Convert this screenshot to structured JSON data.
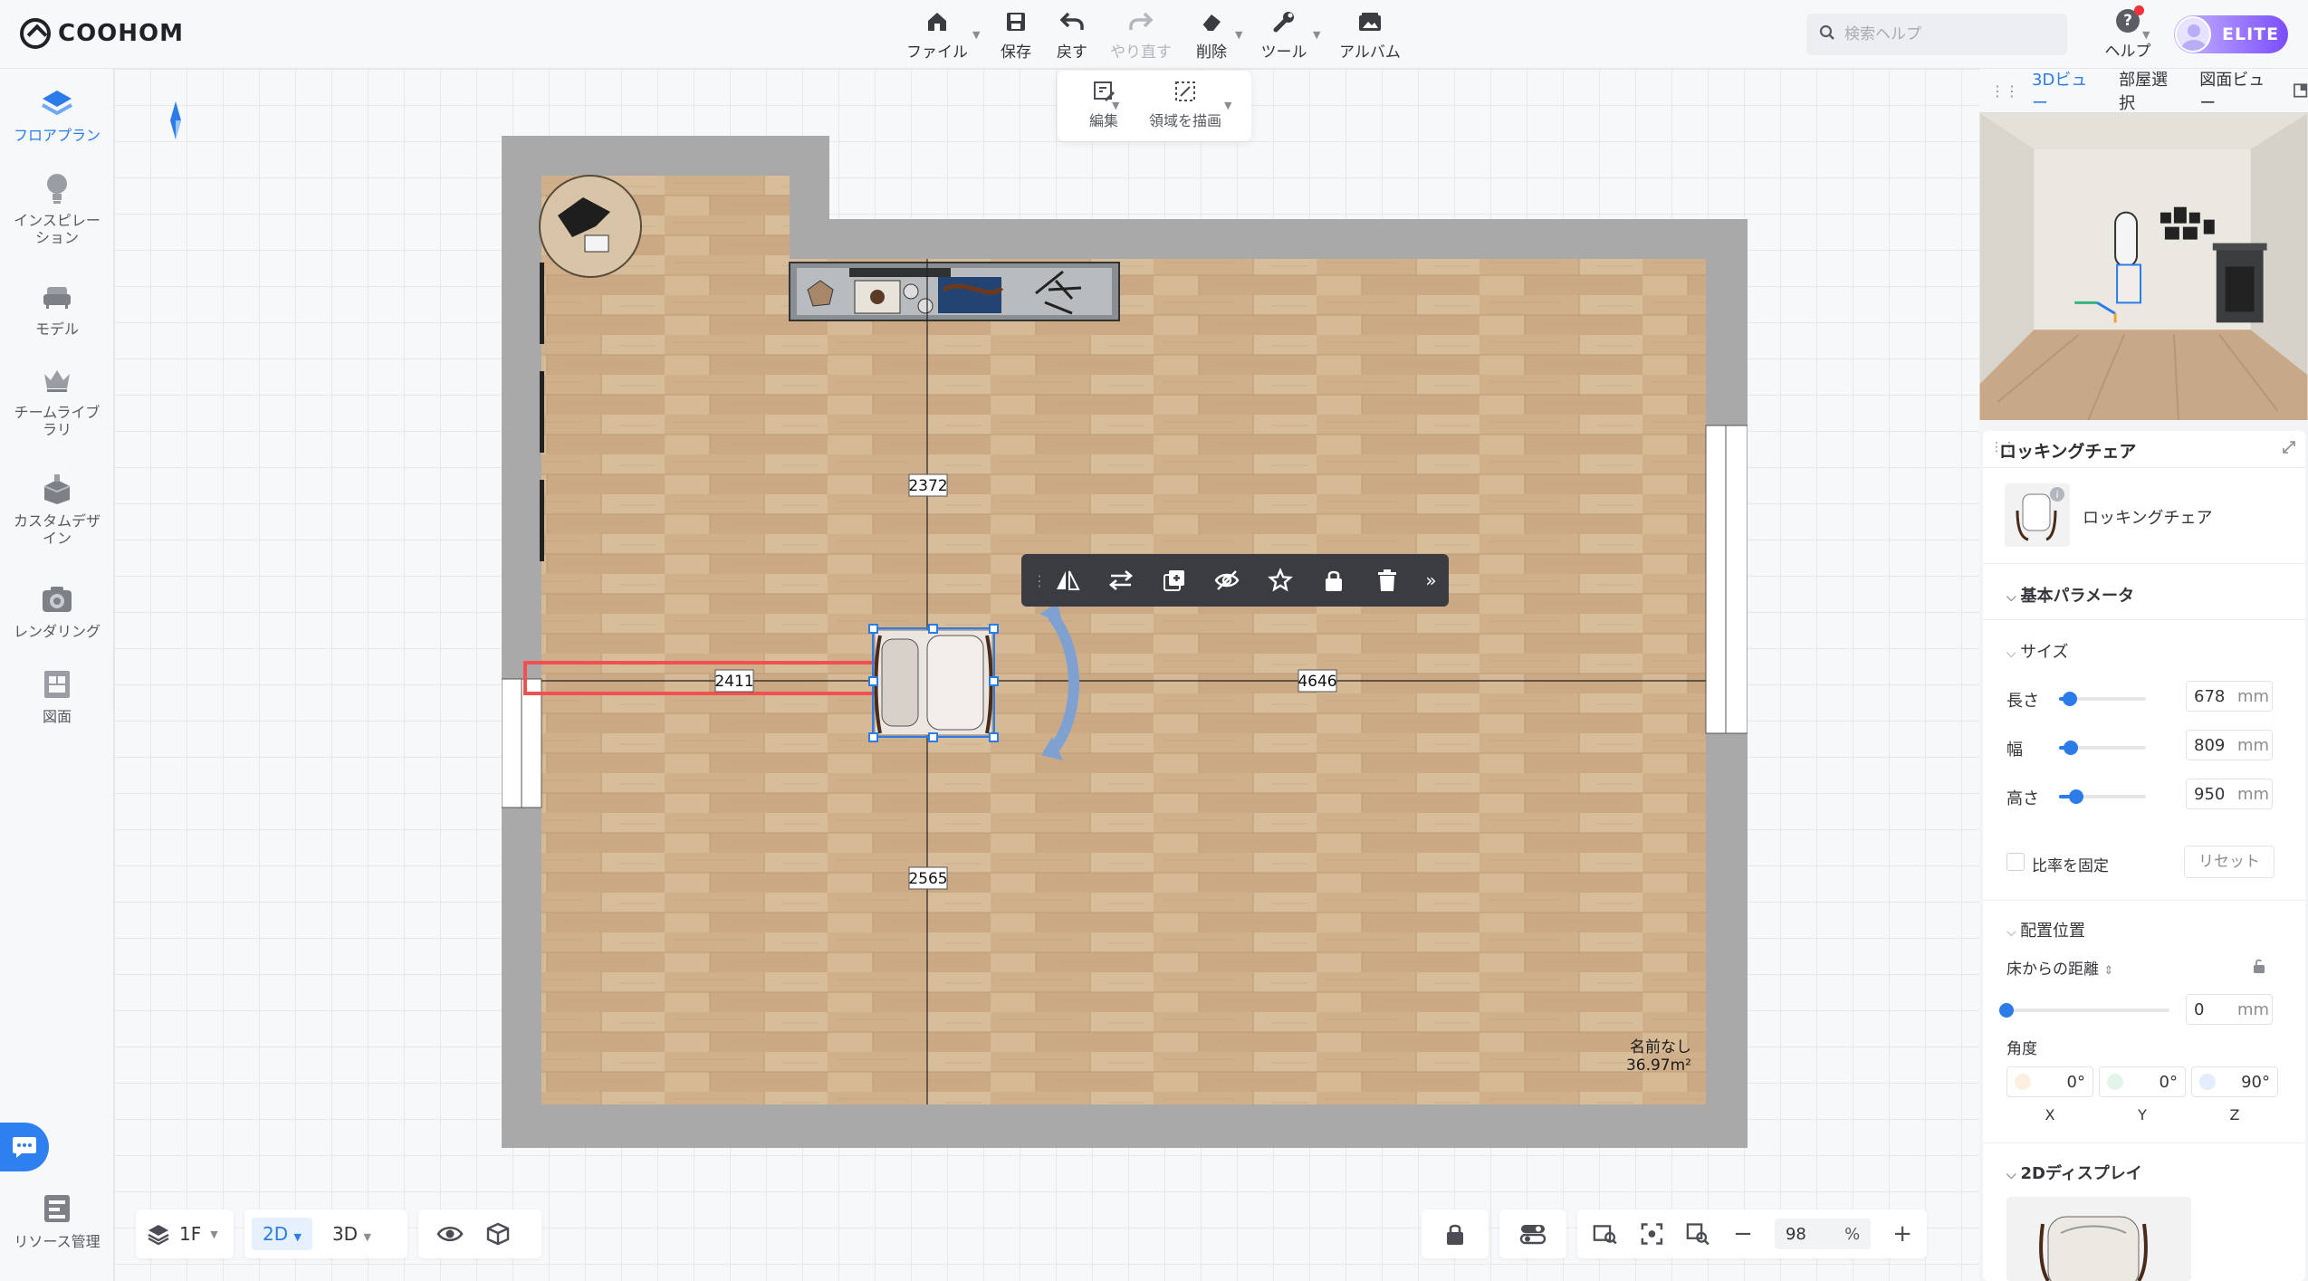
{
  "app": {
    "logo": "COOHOM"
  },
  "toolbar": {
    "file": "ファイル",
    "save": "保存",
    "undo": "戻す",
    "redo": "やり直す",
    "delete": "削除",
    "tools": "ツール",
    "album": "アルバム"
  },
  "search": {
    "placeholder": "検索ヘルプ"
  },
  "help": {
    "label": "ヘルプ"
  },
  "account": {
    "badge": "ELITE"
  },
  "sidebar": {
    "items": [
      {
        "label": "フロアプラン",
        "icon": "floorplan-icon"
      },
      {
        "label": "インスピレーション",
        "icon": "lightbulb-icon"
      },
      {
        "label": "モデル",
        "icon": "sofa-icon"
      },
      {
        "label": "チームライブラリ",
        "icon": "crown-icon"
      },
      {
        "label": "カスタムデザイン",
        "icon": "custom-box-icon"
      },
      {
        "label": "レンダリング",
        "icon": "camera-icon"
      },
      {
        "label": "図面",
        "icon": "drawing-icon"
      }
    ],
    "resource": "リソース管理"
  },
  "edit_popup": {
    "edit": "編集",
    "draw_area": "領域を描画"
  },
  "floorplan": {
    "dimensions": {
      "top": "2372",
      "left": "2411",
      "right": "4646",
      "bottom": "2565"
    },
    "room_name": "名前なし",
    "room_area": "36.97m²"
  },
  "bottom": {
    "floor": "1F",
    "view_2d": "2D",
    "view_3d": "3D",
    "zoom": "98",
    "zoom_unit": "%"
  },
  "rightpanel": {
    "tabs": [
      "3Dビュー",
      "部屋選択",
      "図面ビュー"
    ],
    "object_title": "ロッキングチェア",
    "object_name": "ロッキングチェア",
    "basic_params": "基本パラメータ",
    "size": "サイズ",
    "length_label": "長さ",
    "length": "678",
    "width_label": "幅",
    "width": "809",
    "height_label": "高さ",
    "height": "950",
    "unit": "mm",
    "lock_ratio": "比率を固定",
    "reset": "リセット",
    "placement": "配置位置",
    "floor_distance": "床からの距離",
    "floor_distance_value": "0",
    "angle": "角度",
    "angle_x": "0°",
    "angle_y": "0°",
    "angle_z": "90°",
    "axis_x": "X",
    "axis_y": "Y",
    "axis_z": "Z",
    "display_2d": "2Dディスプレイ",
    "size_fraction": {
      "length": 0.12,
      "width": 0.14,
      "height": 0.2,
      "floor_distance": 0
    }
  },
  "colors": {
    "accent": "#2b7be9",
    "wall": "#a9a9a9",
    "floor": "#cdb08c",
    "selection": "#f05050"
  }
}
